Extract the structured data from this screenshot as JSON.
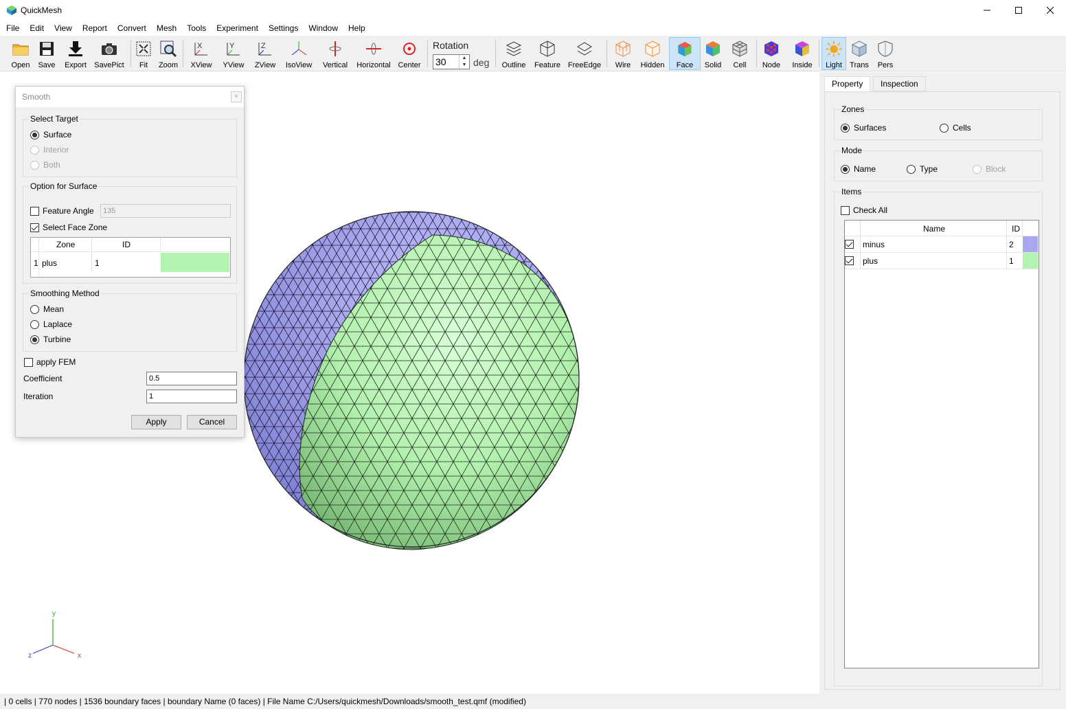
{
  "window": {
    "title": "QuickMesh",
    "minimize": "—",
    "maximize": "☐",
    "close": "✕"
  },
  "menu": [
    "File",
    "Edit",
    "View",
    "Report",
    "Convert",
    "Mesh",
    "Tools",
    "Experiment",
    "Settings",
    "Window",
    "Help"
  ],
  "toolbar": {
    "open": "Open",
    "save": "Save",
    "export": "Export",
    "savepict": "SavePict",
    "fit": "Fit",
    "zoom": "Zoom",
    "xview": "XView",
    "yview": "YView",
    "zview": "ZView",
    "isoview": "IsoView",
    "vertical": "Vertical",
    "horizontal": "Horizontal",
    "center": "Center",
    "rotation_label": "Rotation",
    "rotation_value": "30",
    "rotation_unit": "deg",
    "outline": "Outline",
    "feature": "Feature",
    "freeedge": "FreeEdge",
    "wire": "Wire",
    "hidden": "Hidden",
    "face": "Face",
    "solid": "Solid",
    "cell": "Cell",
    "node": "Node",
    "inside": "Inside",
    "light": "Light",
    "trans": "Trans",
    "pers": "Pers",
    "active": [
      "Face",
      "Light"
    ]
  },
  "smooth_dialog": {
    "title": "Smooth",
    "close": "×",
    "select_target": {
      "title": "Select Target",
      "options": [
        "Surface",
        "Interior",
        "Both"
      ],
      "selected": "Surface",
      "disabled": [
        "Interior",
        "Both"
      ]
    },
    "option_surface": {
      "title": "Option for Surface",
      "feature_angle_label": "Feature Angle",
      "feature_angle_checked": false,
      "feature_angle_value": "135",
      "select_face_zone_label": "Select Face Zone",
      "select_face_zone_checked": true,
      "table": {
        "headers": [
          "Zone",
          "ID"
        ],
        "rows": [
          {
            "index": "1",
            "zone": "plus",
            "id": "1",
            "color": "#b3f5b0"
          }
        ]
      }
    },
    "smoothing_method": {
      "title": "Smoothing Method",
      "options": [
        "Mean",
        "Laplace",
        "Turbine"
      ],
      "selected": "Turbine"
    },
    "apply_fem_label": "apply FEM",
    "apply_fem_checked": false,
    "coefficient_label": "Coefficient",
    "coefficient_value": "0.5",
    "iteration_label": "Iteration",
    "iteration_value": "1",
    "apply_button": "Apply",
    "cancel_button": "Cancel"
  },
  "right_panel": {
    "tabs": [
      "Property",
      "Inspection"
    ],
    "active_tab": "Property",
    "zones": {
      "title": "Zones",
      "options": [
        "Surfaces",
        "Cells"
      ],
      "selected": "Surfaces"
    },
    "mode": {
      "title": "Mode",
      "options": [
        "Name",
        "Type",
        "Block"
      ],
      "selected": "Name",
      "disabled": [
        "Block"
      ]
    },
    "items": {
      "title": "Items",
      "check_all_label": "Check All",
      "check_all_checked": false,
      "headers": [
        "Name",
        "ID"
      ],
      "rows": [
        {
          "name": "minus",
          "id": "2",
          "checked": true,
          "color": "#a8a8f0"
        },
        {
          "name": "plus",
          "id": "1",
          "checked": true,
          "color": "#b3f5b0"
        }
      ]
    }
  },
  "axes": {
    "x": "x",
    "y": "y",
    "z": "z"
  },
  "status_bar": "| 0 cells | 770 nodes | 1536 boundary faces |  boundary Name  (0 faces) | File Name C:/Users/quickmesh/Downloads/smooth_test.qmf (modified)"
}
